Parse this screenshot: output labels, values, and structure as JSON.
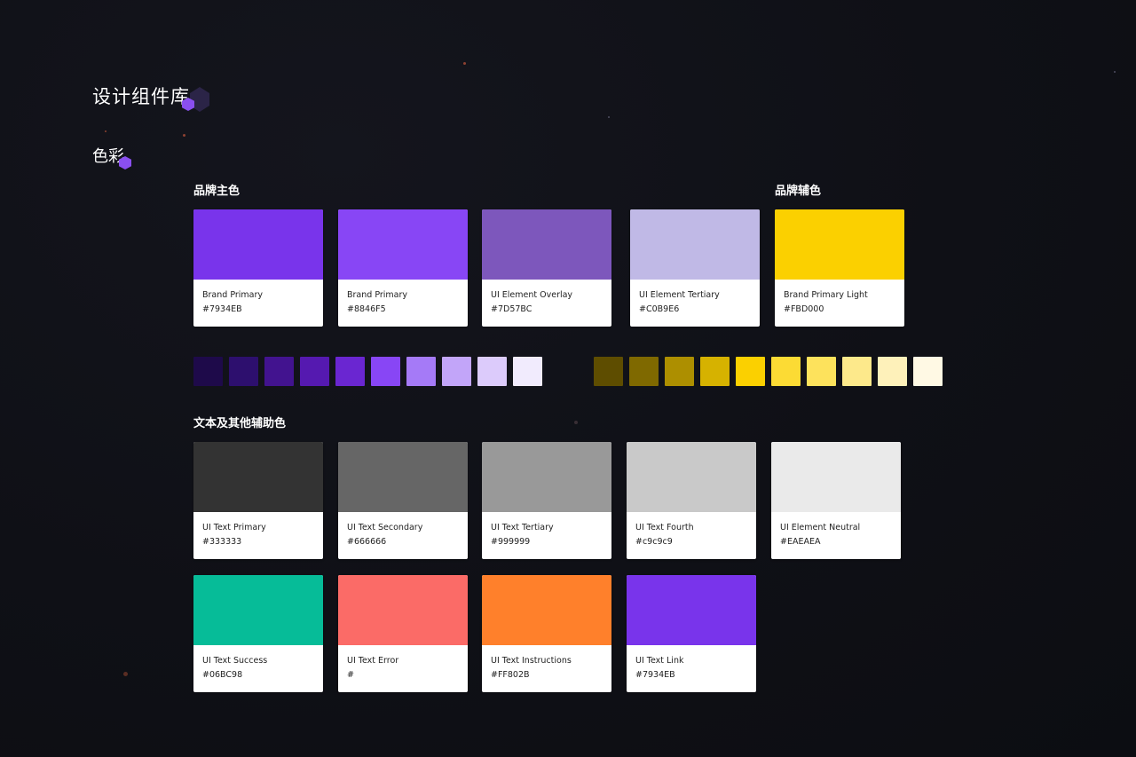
{
  "page": {
    "title": "设计组件库",
    "section_title": "色彩"
  },
  "groups": {
    "brand_primary_label": "品牌主色",
    "brand_secondary_label": "品牌辅色",
    "text_other_label": "文本及其他辅助色"
  },
  "brand_cards": [
    {
      "name": "Brand Primary",
      "hex": "#7934EB",
      "color": "#7934EB"
    },
    {
      "name": "Brand Primary",
      "hex": "#8846F5",
      "color": "#8846F5"
    },
    {
      "name": "UI Element Overlay",
      "hex": "#7D57BC",
      "color": "#7D57BC"
    },
    {
      "name": "UI Element Tertiary",
      "hex": "#C0B9E6",
      "color": "#C0B9E6"
    },
    {
      "name": "Brand Primary Light",
      "hex": "#FBD000",
      "color": "#FBD000"
    }
  ],
  "purple_tints": [
    "#1e0a4a",
    "#2d0f6e",
    "#42138f",
    "#5519b0",
    "#6a26d1",
    "#8846f5",
    "#a57af7",
    "#c2a5f9",
    "#dccbfb",
    "#f1ebfd"
  ],
  "yellow_tints": [
    "#5e4d00",
    "#7f6900",
    "#ad8f00",
    "#d6b200",
    "#fbd000",
    "#fcdb34",
    "#fde25c",
    "#fde98b",
    "#fef1ba",
    "#fff9e4"
  ],
  "text_cards_row1": [
    {
      "name": "UI Text Primary",
      "hex": "#333333",
      "color": "#333333"
    },
    {
      "name": "UI Text Secondary",
      "hex": "#666666",
      "color": "#666666"
    },
    {
      "name": "UI Text Tertiary",
      "hex": "#999999",
      "color": "#999999"
    },
    {
      "name": "UI Text Fourth",
      "hex": "#c9c9c9",
      "color": "#c9c9c9"
    },
    {
      "name": "UI Element Neutral",
      "hex": "#EAEAEA",
      "color": "#EAEAEA"
    }
  ],
  "text_cards_row2": [
    {
      "name": "UI Text Success",
      "hex": "#06BC98",
      "color": "#06BC98"
    },
    {
      "name": "UI Text Error",
      "hex": "#",
      "color": "#FB6B67"
    },
    {
      "name": "UI Text Instructions",
      "hex": "#FF802B",
      "color": "#FF802B"
    },
    {
      "name": "UI Text Link",
      "hex": "#7934EB",
      "color": "#7934EB"
    }
  ],
  "accent": {
    "hex_primary": "#8a4ff0",
    "hex_dark": "#2b2447"
  }
}
